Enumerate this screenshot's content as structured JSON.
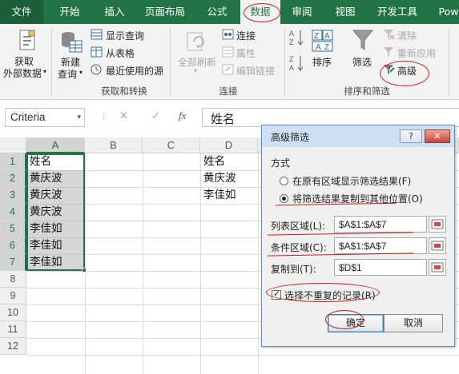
{
  "menu_tabs": [
    {
      "label": "文件"
    },
    {
      "label": "开始"
    },
    {
      "label": "插入"
    },
    {
      "label": "页面布局"
    },
    {
      "label": "公式"
    },
    {
      "label": "数据"
    },
    {
      "label": "审阅"
    },
    {
      "label": "视图"
    },
    {
      "label": "开发工具"
    },
    {
      "label": "Pow"
    }
  ],
  "ribbon": {
    "get_data": {
      "line1": "获取",
      "line2": "外部数据",
      "arrow": "▾"
    },
    "new_query": {
      "line1": "新建",
      "line2": "查询",
      "arrow": "▾"
    },
    "show_query": "显示查询",
    "from_table": "从表格",
    "recent_sources": "最近使用的源",
    "group_get_transform": "获取和转换",
    "refresh_all": {
      "line1": "全部刷新",
      "arrow": "▾"
    },
    "connections": "连接",
    "properties": "属性",
    "edit_links": "编辑链接",
    "group_connections": "连接",
    "sort_az": {
      "top": "A",
      "bottom": "Z"
    },
    "sort_za": {
      "top": "Z",
      "bottom": "A"
    },
    "sort": "排序",
    "filter": "筛选",
    "clear": "清除",
    "reapply": "重新应用",
    "advanced": "高级",
    "group_sort_filter": "排序和筛选"
  },
  "formula_bar": {
    "name_box": "Criteria",
    "name_box_arrow": "▾",
    "cancel": "✕",
    "enter": "✓",
    "fx": "fx",
    "content": "姓名"
  },
  "sheet": {
    "columns": [
      "A",
      "B",
      "C",
      "D"
    ],
    "rows": [
      "1",
      "2",
      "3",
      "4",
      "5",
      "6",
      "7",
      "8",
      "9",
      "10",
      "11",
      "12"
    ],
    "col_a": [
      "姓名",
      "黄庆波",
      "黄庆波",
      "黄庆波",
      "李佳如",
      "李佳如",
      "李佳如"
    ],
    "col_d": [
      "姓名",
      "黄庆波",
      "李佳如"
    ]
  },
  "dialog": {
    "title": "高级筛选",
    "help": "?",
    "close": "✕",
    "section": "方式",
    "option_in_place": "在原有区域显示筛选结果(F)",
    "option_copy": "将筛选结果复制到其他位置(O)",
    "list_range_label": "列表区域(L):",
    "list_range_value": "$A$1:$A$7",
    "criteria_label": "条件区域(C):",
    "criteria_value": "$A$1:$A$7",
    "copy_to_label": "复制到(T):",
    "copy_to_value": "$D$1",
    "unique_label": "选择不重复的记录(R)",
    "ok": "确定",
    "cancel": "取消"
  },
  "colors": {
    "excel_green": "#217346",
    "annotation_red": "#d01818"
  }
}
